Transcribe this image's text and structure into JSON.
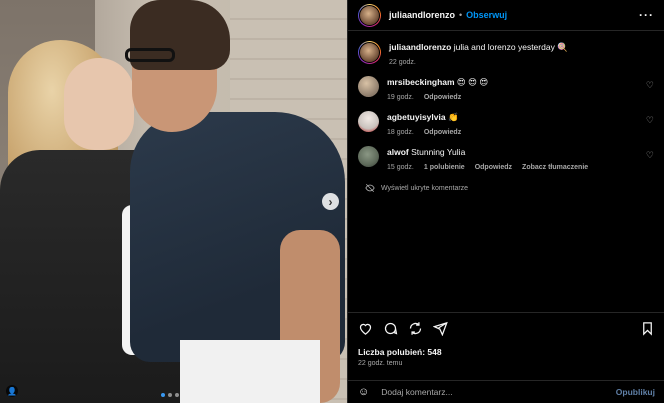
{
  "post": {
    "username": "juliaandlorenzo",
    "separator": "•",
    "follow_label": "Obserwuj",
    "more_label": "···",
    "next_label": "›",
    "tag_label": "👤"
  },
  "caption": {
    "username": "juliaandlorenzo",
    "text": " julia and lorenzo yesterday 🍭",
    "time": "22 godz."
  },
  "comments": [
    {
      "username": "mrsibeckingham",
      "text": " 😍 😍 😍",
      "time": "19 godz.",
      "actions": [
        "Odpowiedz"
      ],
      "avatar_color": "#8c7b6a"
    },
    {
      "username": "agbetuyisylvia",
      "text": " 👏",
      "time": "18 godz.",
      "actions": [
        "Odpowiedz"
      ],
      "avatar_color": "#c9c2bd"
    },
    {
      "username": "alwof",
      "text": " Stunning Yulia",
      "time": "15 godz.",
      "actions": [
        "1 polubienie",
        "Odpowiedz",
        "Zobacz tłumaczenie"
      ],
      "avatar_color": "#5e6a5a"
    }
  ],
  "hidden_comments_label": "Wyświetl ukryte komentarze",
  "likes_label": "Liczba polubień: 548",
  "post_time": "22 godz. temu",
  "add_comment": {
    "placeholder": "Dodaj komentarz...",
    "post_label": "Opublikuj"
  },
  "colors": {
    "accent": "#0095f6",
    "secondary_text": "#a8a8a8",
    "carousel_active": "#3897f0"
  },
  "icons": {
    "like": "heart-icon",
    "comment": "comment-icon",
    "share": "share-icon",
    "direct": "send-icon",
    "save": "bookmark-icon"
  }
}
